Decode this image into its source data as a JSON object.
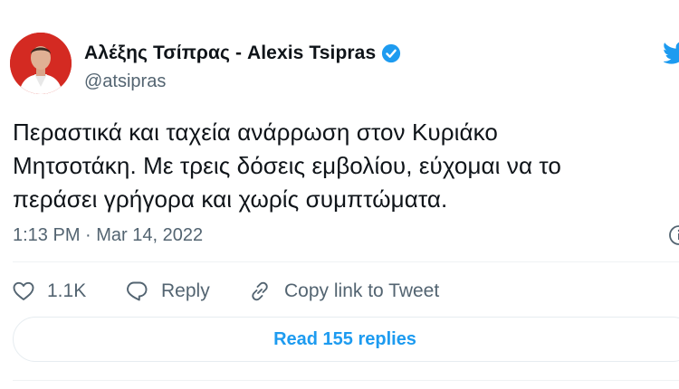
{
  "tweet": {
    "author": {
      "display_name": "Αλέξης Τσίπρας - Alexis Tsipras",
      "handle": "@atsipras",
      "verified": true
    },
    "text": "Περαστικά και ταχεία ανάρρωση στον Κυριάκο\nΜητσοτάκη. Με τρεις δόσεις εμβολίου, εύχομαι να το\nπεράσει γρήγορα και χωρίς συμπτώματα.",
    "timestamp": "1:13 PM · Mar 14, 2022",
    "actions": {
      "like_count": "1.1K",
      "reply_label": "Reply",
      "copy_link_label": "Copy link to Tweet"
    },
    "read_replies_label": "Read 155 replies"
  },
  "icons": {
    "verified": "verified-badge-icon",
    "bird": "twitter-bird-icon",
    "info": "info-icon",
    "like": "heart-icon",
    "reply": "speech-bubble-icon",
    "copy_link": "link-icon"
  },
  "colors": {
    "accent": "#1d9bf0",
    "text_primary": "#0f1419",
    "text_secondary": "#536471",
    "divider": "#eff3f4",
    "avatar_background": "#d42a22"
  }
}
